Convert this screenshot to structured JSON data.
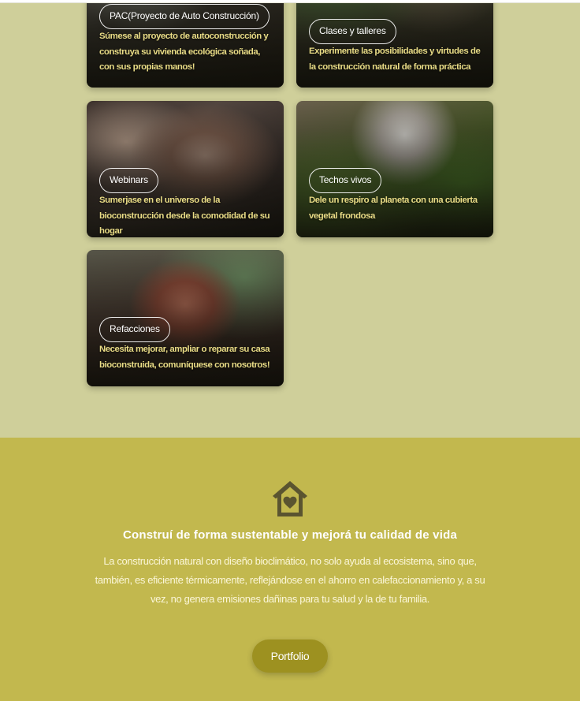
{
  "cards": [
    {
      "tag": "PAC(Proyecto de Auto Construcción)",
      "description": "Súmese al proyecto de autoconstrucción y construya su vivienda ecológica soñada, con sus propias manos!"
    },
    {
      "tag": "Clases y talleres",
      "description": "Experimente las posibilidades y virtudes de la construcción natural de forma práctica"
    },
    {
      "tag": "Webinars",
      "description": "Sumerjase en el universo de la bioconstrucción desde la comodidad de su hogar"
    },
    {
      "tag": "Techos vivos",
      "description": "Dele un respiro al planeta con una cubierta vegetal frondosa"
    },
    {
      "tag": "Refacciones",
      "description": "Necesita mejorar, ampliar o reparar su casa bioconstruida, comuníquese con nosotros!"
    }
  ],
  "feature": {
    "icon": "house-heart-icon",
    "headline": "Construí de forma sustentable y mejorá tu calidad de vida",
    "body": "La construcción natural con diseño bioclimático, no solo ayuda al ecosistema, sino que, también, es eficiente térmicamente, reflejándose en el ahorro en calefaccionamiento y, a su vez, no genera emisiones dañinas para tu salud y la de tu familia.",
    "button_label": "Portfolio"
  },
  "colors": {
    "cards_background": "#cfcf9a",
    "feature_background": "#c2b84e",
    "button": "#9d9120",
    "card_text": "#e9dc86",
    "icon": "#5a5430"
  }
}
